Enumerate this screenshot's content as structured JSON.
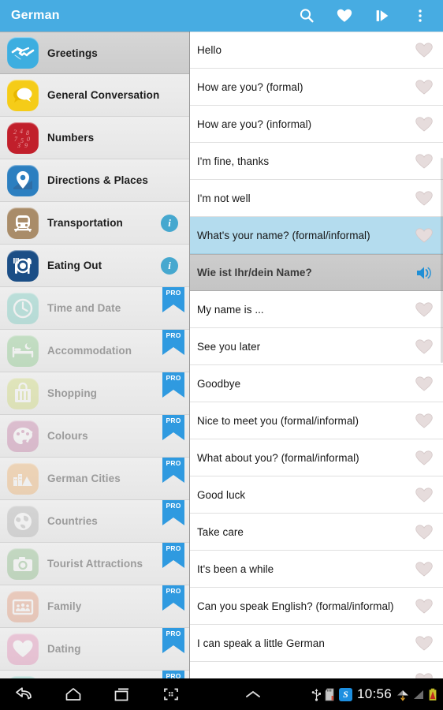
{
  "actionbar": {
    "title": "German",
    "actions": [
      {
        "name": "search-icon",
        "label": "Search"
      },
      {
        "name": "favourites-heart-icon",
        "label": "Favourites"
      },
      {
        "name": "slideshow-play-icon",
        "label": "Slideshow"
      },
      {
        "name": "overflow-menu-icon",
        "label": "More options"
      }
    ]
  },
  "colors": {
    "accent": "#47ace2",
    "selected_row": "#b4dcee",
    "translation_row": "#c8c8c8",
    "pro_badge": "#2f9ae0",
    "info_badge": "#46a8cf"
  },
  "sidebar": {
    "categories": [
      {
        "label": "Greetings",
        "icon": "handshake-icon",
        "icon_color": "#3daee0",
        "selected": true,
        "locked": false,
        "badge": "none"
      },
      {
        "label": "General Conversation",
        "icon": "speech-bubble-icon",
        "icon_color": "#f5cc18",
        "selected": false,
        "locked": false,
        "badge": "none"
      },
      {
        "label": "Numbers",
        "icon": "numbers-icon",
        "icon_color": "#c11f2b",
        "selected": false,
        "locked": false,
        "badge": "none"
      },
      {
        "label": "Directions & Places",
        "icon": "map-pin-icon",
        "icon_color": "#2c7fc0",
        "selected": false,
        "locked": false,
        "badge": "none"
      },
      {
        "label": "Transportation",
        "icon": "train-icon",
        "icon_color": "#a98c69",
        "selected": false,
        "locked": false,
        "badge": "info"
      },
      {
        "label": "Eating Out",
        "icon": "cutlery-icon",
        "icon_color": "#1b4e86",
        "selected": false,
        "locked": false,
        "badge": "info"
      },
      {
        "label": "Time and Date",
        "icon": "clock-icon",
        "icon_color": "#49bfae",
        "selected": false,
        "locked": true,
        "badge": "pro"
      },
      {
        "label": "Accommodation",
        "icon": "bed-icon",
        "icon_color": "#63bb63",
        "selected": false,
        "locked": true,
        "badge": "pro"
      },
      {
        "label": "Shopping",
        "icon": "shopping-bag-icon",
        "icon_color": "#c3d24a",
        "selected": false,
        "locked": true,
        "badge": "pro"
      },
      {
        "label": "Colours",
        "icon": "palette-icon",
        "icon_color": "#b5528a",
        "selected": false,
        "locked": true,
        "badge": "pro"
      },
      {
        "label": "German Cities",
        "icon": "cityscape-icon",
        "icon_color": "#ef9a3d",
        "selected": false,
        "locked": true,
        "badge": "pro"
      },
      {
        "label": "Countries",
        "icon": "globe-icon",
        "icon_color": "#9a9a9a",
        "selected": false,
        "locked": true,
        "badge": "pro"
      },
      {
        "label": "Tourist Attractions",
        "icon": "camera-icon",
        "icon_color": "#64a85e",
        "selected": false,
        "locked": true,
        "badge": "pro"
      },
      {
        "label": "Family",
        "icon": "family-photo-icon",
        "icon_color": "#e07a4e",
        "selected": false,
        "locked": true,
        "badge": "pro"
      },
      {
        "label": "Dating",
        "icon": "heart-icon",
        "icon_color": "#e06aa2",
        "selected": false,
        "locked": true,
        "badge": "pro"
      },
      {
        "label": "",
        "icon": "partial-icon",
        "icon_color": "#49bfae",
        "selected": false,
        "locked": true,
        "badge": "pro"
      }
    ],
    "pro_label": "PRO",
    "info_label": "i"
  },
  "phrases": {
    "items": [
      {
        "text": "Hello",
        "state": "normal",
        "action": "favourite-heart-icon"
      },
      {
        "text": "How are you? (formal)",
        "state": "normal",
        "action": "favourite-heart-icon"
      },
      {
        "text": "How are you? (informal)",
        "state": "normal",
        "action": "favourite-heart-icon"
      },
      {
        "text": "I'm fine, thanks",
        "state": "normal",
        "action": "favourite-heart-icon"
      },
      {
        "text": "I'm not well",
        "state": "normal",
        "action": "favourite-heart-icon"
      },
      {
        "text": "What's your name? (formal/informal)",
        "state": "selected",
        "action": "favourite-heart-icon"
      },
      {
        "text": "Wie ist Ihr/dein Name?",
        "state": "translation",
        "action": "speaker-audio-icon"
      },
      {
        "text": "My name is ...",
        "state": "normal",
        "action": "favourite-heart-icon"
      },
      {
        "text": "See you later",
        "state": "normal",
        "action": "favourite-heart-icon"
      },
      {
        "text": "Goodbye",
        "state": "normal",
        "action": "favourite-heart-icon"
      },
      {
        "text": "Nice to meet you (formal/informal)",
        "state": "normal",
        "action": "favourite-heart-icon"
      },
      {
        "text": "What about you? (formal/informal)",
        "state": "normal",
        "action": "favourite-heart-icon"
      },
      {
        "text": "Good luck",
        "state": "normal",
        "action": "favourite-heart-icon"
      },
      {
        "text": "Take care",
        "state": "normal",
        "action": "favourite-heart-icon"
      },
      {
        "text": "It's been a while",
        "state": "normal",
        "action": "favourite-heart-icon"
      },
      {
        "text": "Can you speak English? (formal/informal)",
        "state": "normal",
        "action": "favourite-heart-icon"
      },
      {
        "text": "I can speak a little German",
        "state": "normal",
        "action": "favourite-heart-icon"
      },
      {
        "text": "",
        "state": "normal",
        "action": "favourite-heart-icon"
      }
    ]
  },
  "navbar": {
    "buttons": [
      {
        "name": "back-button",
        "label": "Back"
      },
      {
        "name": "home-button",
        "label": "Home"
      },
      {
        "name": "recents-button",
        "label": "Recent apps"
      },
      {
        "name": "screenshot-button",
        "label": "Screenshot"
      }
    ],
    "expand_handle": "chevron-up-icon",
    "status": {
      "usb_icon": "usb-icon",
      "sdcard_icon": "sd-card-icon",
      "skype_icon": "skype-icon",
      "skype_letter": "S",
      "clock": "10:56",
      "wifi_icon": "wifi-icon",
      "signal_icon": "signal-bars-icon",
      "battery_icon": "battery-warning-icon"
    }
  }
}
